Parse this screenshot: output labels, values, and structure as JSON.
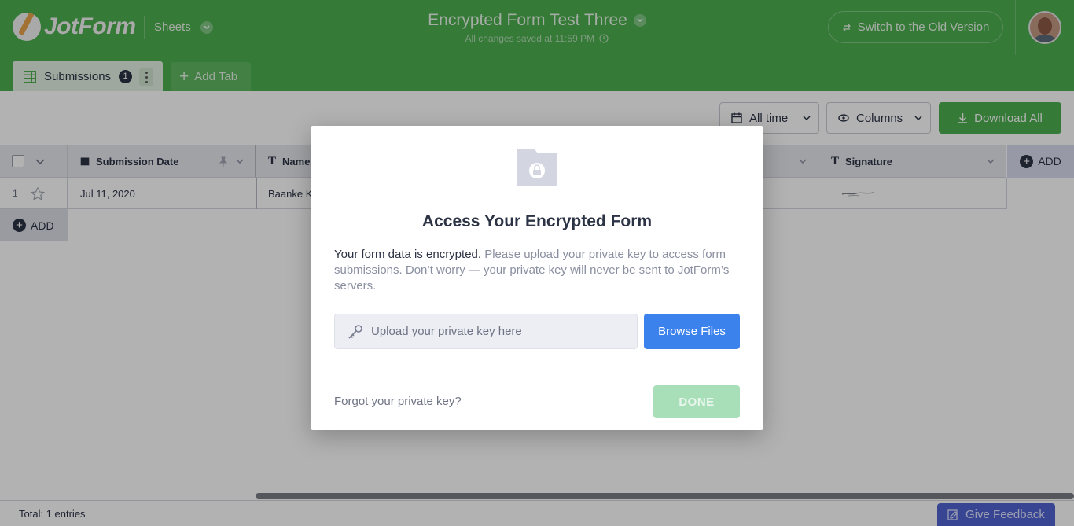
{
  "header": {
    "logo_text": "JotForm",
    "product": "Sheets",
    "form_title": "Encrypted Form Test Three",
    "saved_status": "All changes saved at 11:59 PM",
    "switch_label": "Switch to the Old Version"
  },
  "tabs": {
    "active_label": "Submissions",
    "active_count": "1",
    "add_tab_label": "Add Tab"
  },
  "toolbar": {
    "date_filter": "All time",
    "columns_label": "Columns",
    "download_label": "Download All"
  },
  "grid": {
    "columns": [
      "Submission Date",
      "Name",
      "Signature"
    ],
    "add_column_label": "ADD",
    "rows": [
      {
        "index": "1",
        "submission_date": "Jul 11, 2020",
        "name": "Baanke K"
      }
    ],
    "add_row_label": "ADD"
  },
  "footer": {
    "total": "Total: 1 entries",
    "feedback_label": "Give Feedback"
  },
  "modal": {
    "title": "Access Your Encrypted Form",
    "desc_strong": "Your form data is encrypted.",
    "desc_rest": " Please upload your private key to access form submissions. Don’t worry — your private key will never be sent to JotForm’s servers.",
    "key_placeholder": "Upload your private key here",
    "browse_label": "Browse Files",
    "forgot_label": "Forgot your private key?",
    "done_label": "DONE"
  },
  "colors": {
    "header_green": "#4caf50",
    "browse_blue": "#3b82ec",
    "done_disabled": "#a8dfb8",
    "feedback_blue": "#4f63d2"
  }
}
